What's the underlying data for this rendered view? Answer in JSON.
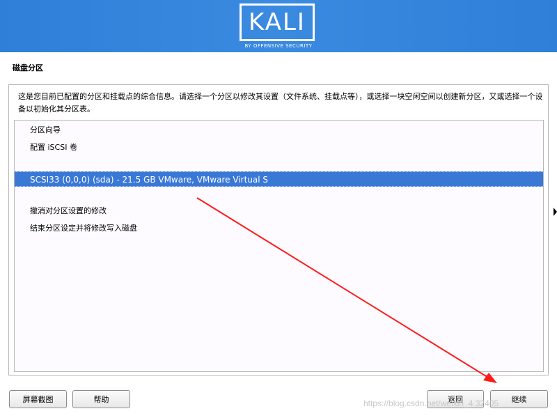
{
  "header": {
    "logo_text": "KALI",
    "logo_subtitle": "BY OFFENSIVE SECURITY",
    "brand_color": "#3a8ae0"
  },
  "page": {
    "title": "磁盘分区",
    "description": "这是您目前已配置的分区和挂载点的综合信息。请选择一个分区以修改其设置（文件系统、挂载点等），或选择一块空闲空间以创建新分区，又或选择一个设备以初始化其分区表。"
  },
  "partition_list": {
    "items": [
      {
        "label": "分区向导",
        "selected": false
      },
      {
        "label": "配置 iSCSI 卷",
        "selected": false
      },
      {
        "label": "SCSI33 (0,0,0) (sda) - 21.5 GB VMware, VMware Virtual S",
        "selected": true
      },
      {
        "label": "撤消对分区设置的修改",
        "selected": false
      },
      {
        "label": "结束分区设定并将修改写入磁盘",
        "selected": false
      }
    ],
    "selected_color": "#3a78d6"
  },
  "buttons": {
    "screenshot": "屏幕截图",
    "help": "帮助",
    "back": "返回",
    "continue": "继续"
  },
  "annotation": {
    "arrow_color": "#ff1a1a",
    "watermark": "https://blog.csdn.net/weixin_4  32405"
  }
}
